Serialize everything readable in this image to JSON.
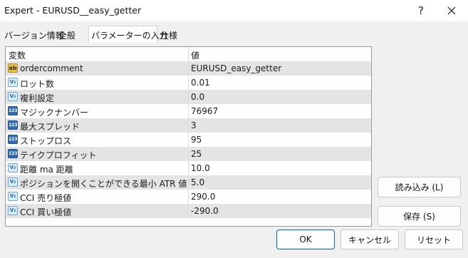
{
  "window": {
    "title": "Expert - EURUSD__easy_getter",
    "help_label": "?"
  },
  "tabs": [
    {
      "label": "バージョン情報"
    },
    {
      "label": "全般"
    },
    {
      "label": "パラメーターの入力"
    },
    {
      "label": "仕様"
    }
  ],
  "grid": {
    "header": {
      "name": "変数",
      "value": "値"
    },
    "rows": [
      {
        "icon": "string-type-icon",
        "icon_text": "ab",
        "name": "ordercomment",
        "value": "EURUSD_easy_getter"
      },
      {
        "icon": "double-type-icon",
        "icon_text": "V₂",
        "name": "ロット数",
        "value": "0.01"
      },
      {
        "icon": "double-type-icon",
        "icon_text": "V₂",
        "name": "複利設定",
        "value": "0.0"
      },
      {
        "icon": "integer-type-icon",
        "icon_text": "123",
        "name": "マジックナンバー",
        "value": "76967"
      },
      {
        "icon": "integer-type-icon",
        "icon_text": "123",
        "name": "最大スプレッド",
        "value": "3"
      },
      {
        "icon": "integer-type-icon",
        "icon_text": "123",
        "name": "ストップロス",
        "value": "95"
      },
      {
        "icon": "integer-type-icon",
        "icon_text": "123",
        "name": "テイクプロフィット",
        "value": "25"
      },
      {
        "icon": "double-type-icon",
        "icon_text": "V₂",
        "name": "距離 ma 距離",
        "value": "10.0"
      },
      {
        "icon": "double-type-icon",
        "icon_text": "V₂",
        "name": "ポジションを開くことができる最小 ATR 値",
        "value": "5.0"
      },
      {
        "icon": "double-type-icon",
        "icon_text": "V₂",
        "name": "CCI 売り極値",
        "value": "290.0"
      },
      {
        "icon": "double-type-icon",
        "icon_text": "V₂",
        "name": "CCI 買い極値",
        "value": "-290.0"
      }
    ]
  },
  "buttons": {
    "load": "読み込み (L)",
    "save": "保存 (S)",
    "ok": "OK",
    "cancel": "キャンセル",
    "reset": "リセット"
  },
  "colors": {
    "accent": "#0067c0",
    "row_alt": "#e4e4e4"
  }
}
